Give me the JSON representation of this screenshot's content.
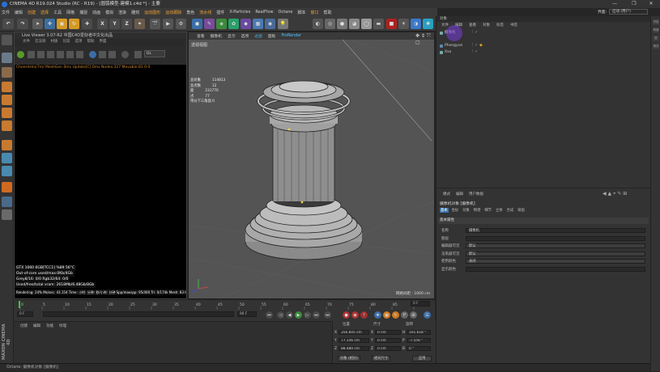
{
  "window": {
    "title": "CINEMA 4D R19.024 Studio (RC - R19) - [圆弧模型-建模1.c4d *] - 主要",
    "controls": [
      "—",
      "❐",
      "✕"
    ]
  },
  "menubar": [
    "文件",
    "编辑",
    "创建",
    "选择",
    "工具",
    "网格",
    "捕捉",
    "动画",
    "模拟",
    "渲染",
    "雕刻",
    "运动图形",
    "运动跟踪",
    "角色",
    "流水线",
    "插件",
    "X-Particles",
    "RealFlow",
    "Octane",
    "脚本",
    "窗口",
    "帮助"
  ],
  "menubar_highlight": [
    "创建",
    "选择",
    "运动图形",
    "运动跟踪",
    "流水线",
    "窗口"
  ],
  "interface": {
    "label": "界面:",
    "value": "启动 (用户)"
  },
  "toolbar_axis": [
    "X",
    "Y",
    "Z"
  ],
  "live_viewer": {
    "title": "Live Viewer 3.07-R2 中国C4D爱好者中文化出品",
    "menu": [
      "文件",
      "云渲染",
      "材质",
      "比较",
      "选项",
      "帮助",
      "界面"
    ],
    "status": "Cheerdsho(7m/ MeshGen 0ms  Update[C]:0ms  Nodes:327 Movable:81  0:0",
    "channel": "DL",
    "stats": [
      "GTX 1060 6GB[TCC1]    %89    56°C",
      "Out-of-core used/max:0Kb/4Gb",
      "Grey8/16: 0/0        Rgb32/64: 0/0",
      "Used/free/total vram: 2618Mb/6.48Gb/8Gb",
      "Rendering: 24%  Ms/sec: 43.154   Time: 小时: 分钟: 秒/小时: 分钟   Spp/maxspp: 95/400   Tri: 0/174k   Mesh: 83   Hair: 0"
    ]
  },
  "viewport": {
    "menu": [
      "查看",
      "摄像机",
      "显示",
      "选项",
      "过滤",
      "面板",
      "ProRender"
    ],
    "label": "透视视图",
    "stats": [
      [
        "总对象",
        "114813"
      ],
      [
        "总点数",
        "12"
      ],
      [
        "面",
        "231770"
      ],
      [
        "点",
        "77"
      ],
      [
        "带分下三角面 0",
        ""
      ]
    ],
    "grid_spacing": "网格间距 : 1000 cm"
  },
  "object_manager": {
    "title": "对象",
    "menu": [
      "文件",
      "编辑",
      "查看",
      "对象",
      "标签",
      "书签"
    ],
    "items": [
      {
        "name": "摄像机"
      },
      {
        "name": "Phongyun"
      },
      {
        "name": "Xxx"
      }
    ]
  },
  "attributes": {
    "menu": [
      "模式",
      "编辑",
      "用户数据"
    ],
    "type": "摄像机对象 [摄像机]",
    "tabs": [
      "基本",
      "坐标",
      "对象",
      "物理",
      "细节",
      "立体",
      "合成",
      "球面"
    ],
    "active_tab": "基本",
    "section": "基本属性",
    "props": [
      {
        "label": "名称",
        "value": "摄像机"
      },
      {
        "label": "图层",
        "value": ""
      },
      {
        "label": "编辑器可见",
        "value": "默认"
      },
      {
        "label": "渲染器可见",
        "value": "默认"
      },
      {
        "label": "使用颜色",
        "value": "关闭"
      },
      {
        "label": "显示颜色",
        "value": ""
      }
    ]
  },
  "timeline": {
    "ticks": [
      "0",
      "5",
      "10",
      "15",
      "20",
      "25",
      "30",
      "35",
      "40",
      "45",
      "50",
      "55",
      "60",
      "65",
      "70",
      "75",
      "80",
      "85",
      "90"
    ],
    "end_frame": "0 F",
    "start": "0 F",
    "current": "90 F",
    "end": "90 F"
  },
  "material_manager": {
    "menu": [
      "创建",
      "编辑",
      "功能",
      "纹理"
    ]
  },
  "coordinates": {
    "headers": [
      "位置",
      "尺寸",
      "旋转"
    ],
    "rows": [
      {
        "axis": "X",
        "pos": "356.605 cm",
        "size": "0 cm",
        "rlabel": "H",
        "rot": "101.618 °"
      },
      {
        "axis": "Y",
        "pos": "77.156 cm",
        "size": "0 cm",
        "rlabel": "P",
        "rot": "-7.556 °"
      },
      {
        "axis": "Z",
        "pos": "88.489 cm",
        "size": "0 cm",
        "rlabel": "B",
        "rot": "0 °"
      }
    ],
    "mode1": "对象 (相对)",
    "mode2": "绝对尺寸",
    "apply": "应用"
  },
  "statusbar": "Octane: 摄像机对象 [摄像机]",
  "brand": "MAXON CINEMA 4D",
  "sidebar_tabs": [
    "内容浏览器",
    "构造",
    "层",
    "场次"
  ]
}
